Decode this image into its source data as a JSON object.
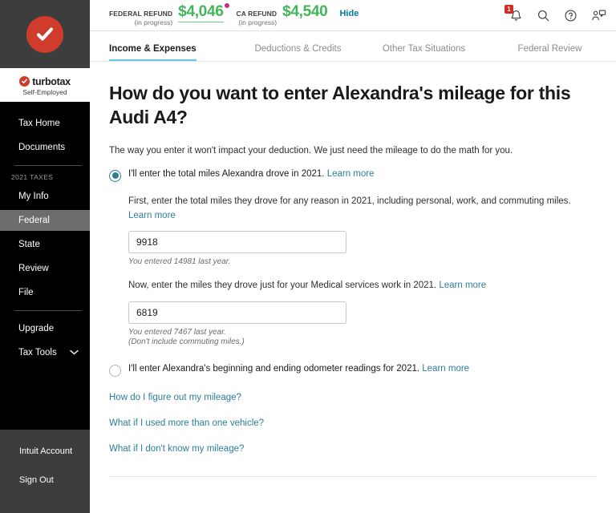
{
  "sidebar": {
    "logo_icon": "turbotax-check-logo",
    "brand_name": "turbotax",
    "brand_suffix": ".",
    "brand_sub": "Self-Employed",
    "items": [
      {
        "label": "Tax Home",
        "active": false
      },
      {
        "label": "Documents",
        "active": false
      }
    ],
    "section_label": "2021 TAXES",
    "tax_items": [
      {
        "label": "My Info",
        "active": false
      },
      {
        "label": "Federal",
        "active": true
      },
      {
        "label": "State",
        "active": false
      },
      {
        "label": "Review",
        "active": false
      },
      {
        "label": "File",
        "active": false
      }
    ],
    "tools_items": [
      {
        "label": "Upgrade",
        "caret": false
      },
      {
        "label": "Tax Tools",
        "caret": true
      }
    ],
    "bottom_items": [
      {
        "label": "Intuit Account"
      },
      {
        "label": "Sign Out"
      }
    ]
  },
  "topbar": {
    "federal": {
      "label": "FEDERAL REFUND",
      "status": "(in progress)",
      "amount": "$4,046",
      "has_dot": true
    },
    "state": {
      "label": "CA REFUND",
      "status": "(in progress)",
      "amount": "$4,540"
    },
    "hide_label": "Hide",
    "icons": {
      "notifications": {
        "name": "bell-icon",
        "badge": "1"
      },
      "search": {
        "name": "search-icon"
      },
      "help": {
        "name": "help-circle-icon"
      },
      "live_help": {
        "name": "person-chat-icon"
      }
    }
  },
  "tabs": [
    {
      "label": "Income & Expenses",
      "active": true
    },
    {
      "label": "Deductions & Credits",
      "active": false
    },
    {
      "label": "Other Tax Situations",
      "active": false
    },
    {
      "label": "Federal Review",
      "active": false
    }
  ],
  "page": {
    "heading": "How do you want to enter Alexandra's mileage for this Audi A4?",
    "lede": "The way you enter it won't impact your deduction. We just need the mileage to do the math for you.",
    "option1": {
      "label": "I'll enter the total miles Alexandra drove in 2021.",
      "learn_more": "Learn more",
      "selected": true,
      "field1": {
        "desc": "First, enter the total miles they drove for any reason in 2021, including personal, work, and commuting miles.",
        "learn_more": "Learn more",
        "value": "9918",
        "hint": "You entered 14981 last year."
      },
      "field2": {
        "desc": "Now, enter the miles they drove just for your Medical services work in 2021.",
        "learn_more": "Learn more",
        "value": "6819",
        "hint": "You entered 7467 last year.",
        "hint2": "(Don't include commuting miles.)"
      }
    },
    "option2": {
      "label": "I'll enter Alexandra's beginning and ending odometer readings for 2021.",
      "learn_more": "Learn more",
      "selected": false
    },
    "help_links": [
      "How do I figure out my mileage?",
      "What if I used more than one vehicle?",
      "What if I don't know my mileage?"
    ]
  },
  "colors": {
    "brand_red": "#cf3c2c",
    "refund_green": "#41b658",
    "link_blue": "#2d7d9a",
    "accent_teal": "#2a7f94",
    "tab_underline": "#6cc6e8",
    "badge_red": "#d52b1e",
    "dot_magenta": "#c92d8a"
  }
}
